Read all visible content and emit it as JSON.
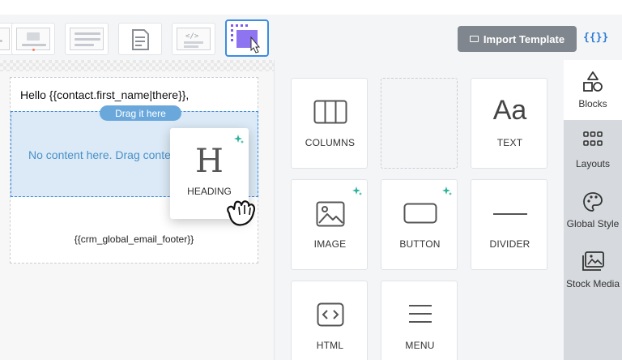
{
  "toolbar": {
    "import_label": "Import Template",
    "merge_tags_label": "{{}}"
  },
  "canvas": {
    "greeting": "Hello {{contact.first_name|there}},",
    "drop_zone_text": "No content here. Drag content",
    "drag_pill": "Drag it here",
    "footer_merge": "{{crm_global_email_footer}}"
  },
  "dragged_block": {
    "label": "HEADING",
    "glyph": "H",
    "icon": "heading-icon",
    "ai_sparkle": true
  },
  "blocks": [
    {
      "label": "COLUMNS",
      "icon": "columns-icon",
      "ai_sparkle": false
    },
    {
      "label": "",
      "icon": "",
      "placeholder": true
    },
    {
      "label": "TEXT",
      "icon": "text-icon",
      "glyph": "Aa",
      "ai_sparkle": false
    },
    {
      "label": "IMAGE",
      "icon": "image-icon",
      "ai_sparkle": true
    },
    {
      "label": "BUTTON",
      "icon": "button-icon",
      "ai_sparkle": true
    },
    {
      "label": "DIVIDER",
      "icon": "divider-icon",
      "ai_sparkle": false
    },
    {
      "label": "HTML",
      "icon": "html-code-icon",
      "ai_sparkle": false
    },
    {
      "label": "MENU",
      "icon": "menu-icon",
      "ai_sparkle": false
    }
  ],
  "right_tabs": [
    {
      "label": "Blocks",
      "icon": "blocks-shapes-icon",
      "active": true
    },
    {
      "label": "Layouts",
      "icon": "layouts-grid-icon",
      "active": false
    },
    {
      "label": "Global Style",
      "icon": "palette-icon",
      "active": false
    },
    {
      "label": "Stock Media",
      "icon": "stock-media-icon",
      "active": false
    }
  ],
  "colors": {
    "accent_blue": "#3b8de0",
    "drop_zone_bg": "#dbeaf6",
    "import_button_bg": "#7f868d",
    "sparkle_teal": "#2bb39a",
    "active_template_purple": "#7b5cf0"
  }
}
